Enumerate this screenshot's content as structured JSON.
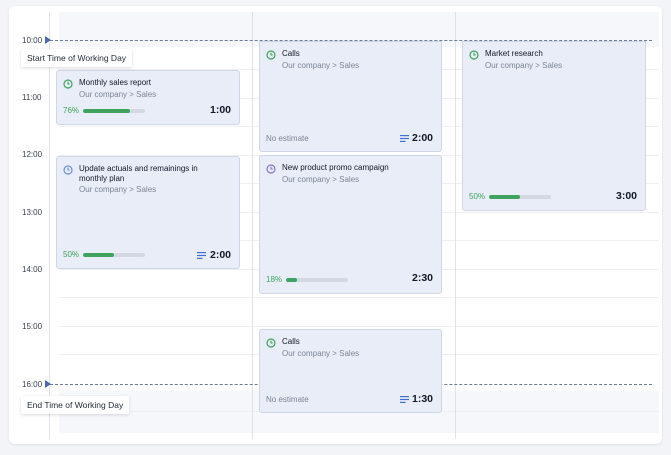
{
  "timeline": {
    "hours": [
      "10:00",
      "11:00",
      "12:00",
      "13:00",
      "14:00",
      "15:00",
      "16:00"
    ],
    "start_label": "Start Time of Working Day",
    "end_label": "End Time of Working Day"
  },
  "cards": [
    {
      "title": "Monthly sales report",
      "subtitle": "Our company > Sales",
      "progress_text": "76%",
      "progress": 0.76,
      "duration": "1:00",
      "icon": "clock-icon"
    },
    {
      "title": "Update actuals and remainings in monthly plan",
      "subtitle": "Our company > Sales",
      "progress_text": "50%",
      "progress": 0.5,
      "duration": "2:00",
      "icon": "clock-icon"
    },
    {
      "title": "Calls",
      "subtitle": "Our company > Sales",
      "estimate": "No estimate",
      "duration": "2:00",
      "icon": "clock-icon"
    },
    {
      "title": "New product promo campaign",
      "subtitle": "Our company > Sales",
      "progress_text": "18%",
      "progress": 0.18,
      "duration": "2:30",
      "icon": "clock-icon"
    },
    {
      "title": "Calls",
      "subtitle": "Our company > Sales",
      "estimate": "No estimate",
      "duration": "1:30",
      "icon": "clock-icon"
    },
    {
      "title": "Market research",
      "subtitle": "Our company > Sales",
      "progress_text": "50%",
      "progress": 0.5,
      "duration": "3:00",
      "icon": "clock-icon"
    }
  ],
  "colors": {
    "progress": "#3da35d",
    "card_bg": "#e9edf7",
    "clock_green": "#3da35d",
    "clock_blue": "#6b8fd6",
    "clock_purple": "#8a73c9",
    "list_icon": "#3d6fd6",
    "marker": "#4a6aa8"
  }
}
